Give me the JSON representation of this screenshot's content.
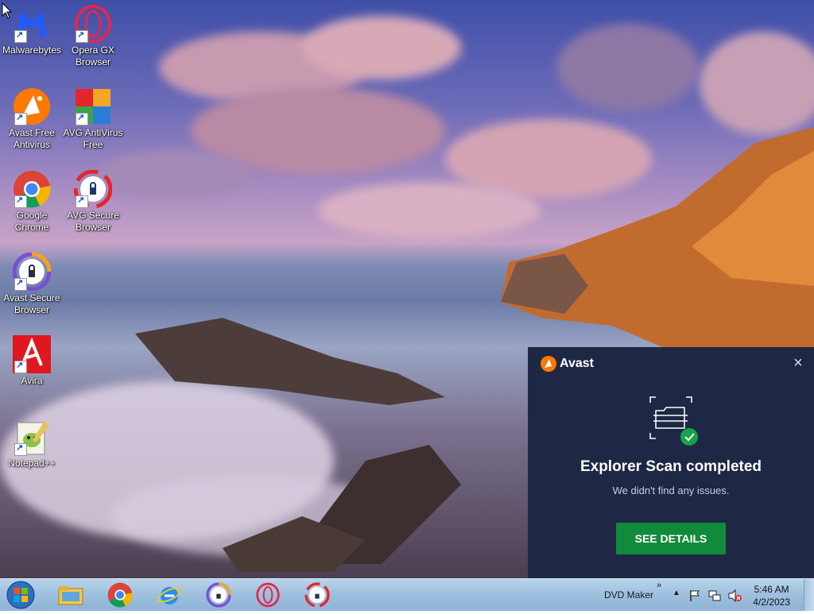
{
  "desktop_icons": [
    {
      "label": "Malwarebytes",
      "icon": "malwarebytes-icon"
    },
    {
      "label": "Opera GX Browser",
      "icon": "opera-gx-icon"
    },
    {
      "label": "Avast Free Antivirus",
      "icon": "avast-icon"
    },
    {
      "label": "AVG AntiVirus Free",
      "icon": "avg-icon"
    },
    {
      "label": "Google Chrome",
      "icon": "chrome-icon"
    },
    {
      "label": "AVG Secure Browser",
      "icon": "avg-secure-browser-icon"
    },
    {
      "label": "Avast Secure Browser",
      "icon": "avast-secure-browser-icon"
    },
    {
      "label": "Avira",
      "icon": "avira-icon"
    },
    {
      "label": "Notepad++",
      "icon": "notepad-plus-plus-icon"
    }
  ],
  "notification": {
    "brand": "Avast",
    "title": "Explorer Scan completed",
    "subtitle": "We didn't find any issues.",
    "button_label": "SEE DETAILS",
    "accent_color": "#118a3b",
    "background_color": "#1e2845"
  },
  "taskbar": {
    "pinned": [
      "start-button",
      "file-explorer-icon",
      "chrome-icon",
      "internet-explorer-icon",
      "avast-secure-browser-icon",
      "opera-icon",
      "avg-secure-browser-icon"
    ],
    "toolbar_label": "DVD Maker",
    "toolbar_chevron": "»",
    "clock_time": "5:46 AM",
    "clock_date": "4/2/2023"
  }
}
